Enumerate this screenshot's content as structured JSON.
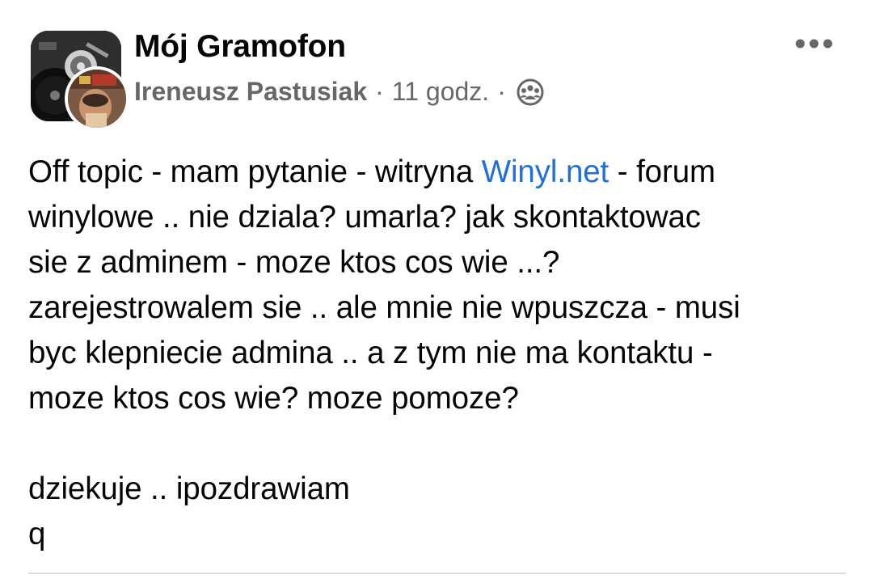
{
  "post": {
    "group_name": "Mój Gramofon",
    "author": "Ireneusz Pastusiak",
    "separator": "·",
    "time": "11 godz.",
    "privacy_icon": "members-group-icon",
    "more_icon": "more-options-icon",
    "body": {
      "line1_before": "Off topic - mam pytanie - witryna ",
      "link_text": "Winyl.net",
      "line1_after": " - forum",
      "rest": "winylowe .. nie dziala? umarla? jak skontaktowac\nsie z adminem - moze ktos cos wie ...?\nzarejestrowalem sie .. ale mnie nie wpuszcza - musi\nbyc klepniecie admina .. a z tym nie ma kontaktu -\nmoze ktos cos wie? moze pomoze?\n\ndziekuje .. ipozdrawiam\nq"
    }
  },
  "colors": {
    "text": "#050505",
    "meta": "#65676b",
    "link": "#216fdb",
    "divider": "#dadde1"
  }
}
